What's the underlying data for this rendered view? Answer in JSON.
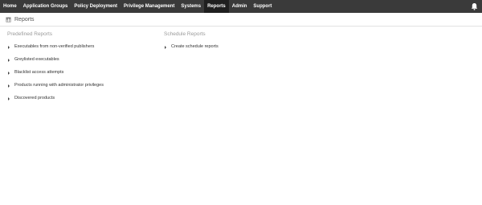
{
  "nav": {
    "items": [
      {
        "label": "Home"
      },
      {
        "label": "Application Groups"
      },
      {
        "label": "Policy Deployment"
      },
      {
        "label": "Privilege Management"
      },
      {
        "label": "Systems"
      },
      {
        "label": "Reports",
        "active": true
      },
      {
        "label": "Admin"
      },
      {
        "label": "Support"
      }
    ],
    "notification_icon": "bell-icon"
  },
  "page": {
    "title": "Reports",
    "icon": "report-icon"
  },
  "predefined": {
    "heading": "Predefined Reports",
    "items": [
      {
        "label": "Executables from non-verified publishers"
      },
      {
        "label": "Greylisted executables"
      },
      {
        "label": "Blacklist access attempts"
      },
      {
        "label": "Products running with administrator privileges"
      },
      {
        "label": "Discovered products"
      }
    ]
  },
  "schedule": {
    "heading": "Schedule Reports",
    "items": [
      {
        "label": "Create schedule reports"
      }
    ]
  }
}
